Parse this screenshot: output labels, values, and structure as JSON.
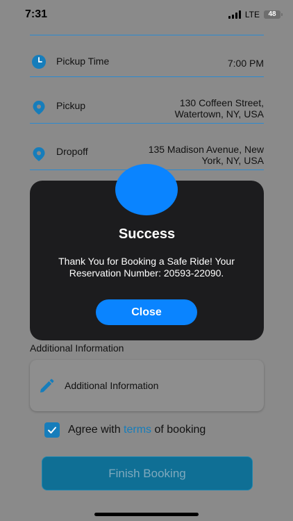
{
  "status_bar": {
    "time": "7:31",
    "network": "LTE",
    "battery": "48"
  },
  "booking": {
    "pickup_time": {
      "label": "Pickup Time",
      "value": "7:00 PM"
    },
    "pickup": {
      "label": "Pickup",
      "line1": "130 Coffeen Street,",
      "line2": "Watertown, NY, USA"
    },
    "dropoff": {
      "label": "Dropoff",
      "line1": "135 Madison Avenue, New",
      "line2": "York, NY, USA"
    }
  },
  "additional": {
    "section_label": "Additional Information",
    "placeholder": "Additional Information"
  },
  "agree": {
    "prefix": "Agree with ",
    "link": "terms",
    "suffix": " of booking",
    "checked": true
  },
  "finish_button": "Finish Booking",
  "modal": {
    "title": "Success",
    "message": "Thank You for Booking a Safe Ride! Your Reservation Number: 20593-22090.",
    "close_label": "Close"
  },
  "icons": {
    "clock": "clock-icon",
    "pin": "location-pin-icon",
    "pencil": "pencil-icon",
    "check": "checkmark-icon"
  },
  "colors": {
    "accent": "#167dbb",
    "modal_bg": "#1c1c1e",
    "modal_button": "#0a84ff"
  }
}
